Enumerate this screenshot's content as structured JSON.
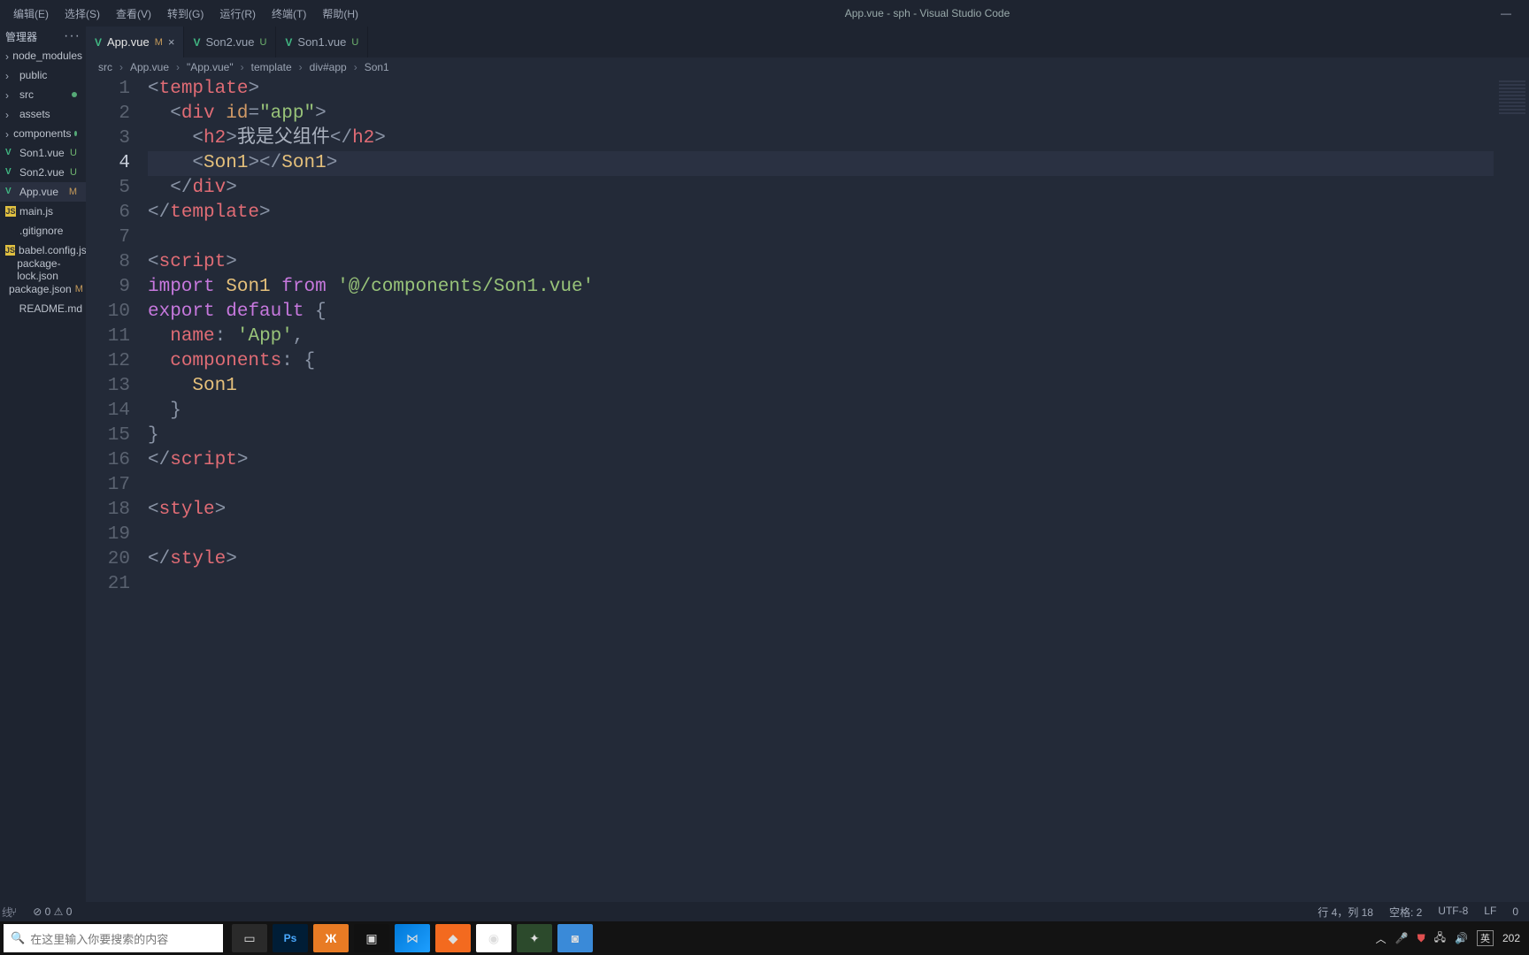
{
  "menu": {
    "items": [
      "编辑(E)",
      "选择(S)",
      "查看(V)",
      "转到(G)",
      "运行(R)",
      "终端(T)",
      "帮助(H)"
    ],
    "title": "App.vue - sph - Visual Studio Code"
  },
  "explorer": {
    "header": "管理器",
    "tree": [
      {
        "label": "node_modules",
        "type": "folder"
      },
      {
        "label": "public",
        "type": "folder"
      },
      {
        "label": "src",
        "type": "folder",
        "dot": true
      },
      {
        "label": "assets",
        "type": "folder"
      },
      {
        "label": "components",
        "type": "folder",
        "dot": true
      },
      {
        "label": "Son1.vue",
        "type": "vue",
        "badge": "U"
      },
      {
        "label": "Son2.vue",
        "type": "vue",
        "badge": "U"
      },
      {
        "label": "App.vue",
        "type": "vue",
        "badge": "M",
        "sel": true
      },
      {
        "label": "main.js",
        "type": "js"
      },
      {
        "label": ".gitignore",
        "type": "cfg"
      },
      {
        "label": "babel.config.js",
        "type": "js"
      },
      {
        "label": "package-lock.json",
        "type": "json"
      },
      {
        "label": "package.json",
        "type": "json",
        "badge": "M"
      },
      {
        "label": "README.md",
        "type": "md"
      }
    ]
  },
  "tabs": [
    {
      "label": "App.vue",
      "status": "M",
      "active": true,
      "close": true
    },
    {
      "label": "Son2.vue",
      "status": "U",
      "active": false
    },
    {
      "label": "Son1.vue",
      "status": "U",
      "active": false
    }
  ],
  "crumbs": [
    "src",
    "App.vue",
    "\"App.vue\"",
    "template",
    "div#app",
    "Son1"
  ],
  "editor": {
    "current_line": 4,
    "lines": [
      [
        [
          "<",
          "t-pun"
        ],
        [
          "template",
          "t-tag"
        ],
        [
          ">",
          "t-pun"
        ]
      ],
      [
        [
          "  ",
          ""
        ],
        [
          "<",
          "t-pun"
        ],
        [
          "div",
          "t-tag"
        ],
        [
          " ",
          ""
        ],
        [
          "id",
          "t-attr"
        ],
        [
          "=",
          "t-pun"
        ],
        [
          "\"app\"",
          "t-str"
        ],
        [
          ">",
          "t-pun"
        ]
      ],
      [
        [
          "    ",
          ""
        ],
        [
          "<",
          "t-pun"
        ],
        [
          "h2",
          "t-tag"
        ],
        [
          ">",
          "t-pun"
        ],
        [
          "我是父组件",
          "t-text"
        ],
        [
          "</",
          "t-pun"
        ],
        [
          "h2",
          "t-tag"
        ],
        [
          ">",
          "t-pun"
        ]
      ],
      [
        [
          "    ",
          ""
        ],
        [
          "<",
          "t-pun"
        ],
        [
          "Son1",
          "t-id"
        ],
        [
          "></",
          "t-pun"
        ],
        [
          "Son1",
          "t-id"
        ],
        [
          ">",
          "t-pun"
        ]
      ],
      [
        [
          "  ",
          ""
        ],
        [
          "</",
          "t-pun"
        ],
        [
          "div",
          "t-tag"
        ],
        [
          ">",
          "t-pun"
        ]
      ],
      [
        [
          "</",
          "t-pun"
        ],
        [
          "template",
          "t-tag"
        ],
        [
          ">",
          "t-pun"
        ]
      ],
      [],
      [
        [
          "<",
          "t-pun"
        ],
        [
          "script",
          "t-tag"
        ],
        [
          ">",
          "t-pun"
        ]
      ],
      [
        [
          "import",
          "t-kw"
        ],
        [
          " ",
          ""
        ],
        [
          "Son1",
          "t-id"
        ],
        [
          " ",
          ""
        ],
        [
          "from",
          "t-kw"
        ],
        [
          " ",
          ""
        ],
        [
          "'@/components/Son1.vue'",
          "t-str"
        ]
      ],
      [
        [
          "export",
          "t-kw"
        ],
        [
          " ",
          ""
        ],
        [
          "default",
          "t-kw"
        ],
        [
          " {",
          "t-pun"
        ]
      ],
      [
        [
          "  ",
          ""
        ],
        [
          "name",
          "t-prop"
        ],
        [
          ": ",
          "t-pun"
        ],
        [
          "'App'",
          "t-str"
        ],
        [
          ",",
          "t-pun"
        ]
      ],
      [
        [
          "  ",
          ""
        ],
        [
          "components",
          "t-prop"
        ],
        [
          ": {",
          "t-pun"
        ]
      ],
      [
        [
          "    ",
          ""
        ],
        [
          "Son1",
          "t-id"
        ]
      ],
      [
        [
          "  }",
          "t-pun"
        ]
      ],
      [
        [
          "}",
          "t-pun"
        ]
      ],
      [
        [
          "</",
          "t-pun"
        ],
        [
          "script",
          "t-tag"
        ],
        [
          ">",
          "t-pun"
        ]
      ],
      [],
      [
        [
          "<",
          "t-pun"
        ],
        [
          "style",
          "t-tag"
        ],
        [
          ">",
          "t-pun"
        ]
      ],
      [],
      [
        [
          "</",
          "t-pun"
        ],
        [
          "style",
          "t-tag"
        ],
        [
          ">",
          "t-pun"
        ]
      ],
      []
    ]
  },
  "panel_label": "线",
  "status": {
    "left": [
      "⊘ 0 ⚠ 0"
    ],
    "right": [
      "行 4，列 18",
      "空格: 2",
      "UTF-8",
      "LF"
    ],
    "far_right": "0"
  },
  "taskbar": {
    "search_placeholder": "在这里输入你要搜索的内容",
    "sys": {
      "ime": "英",
      "date": "202"
    }
  }
}
